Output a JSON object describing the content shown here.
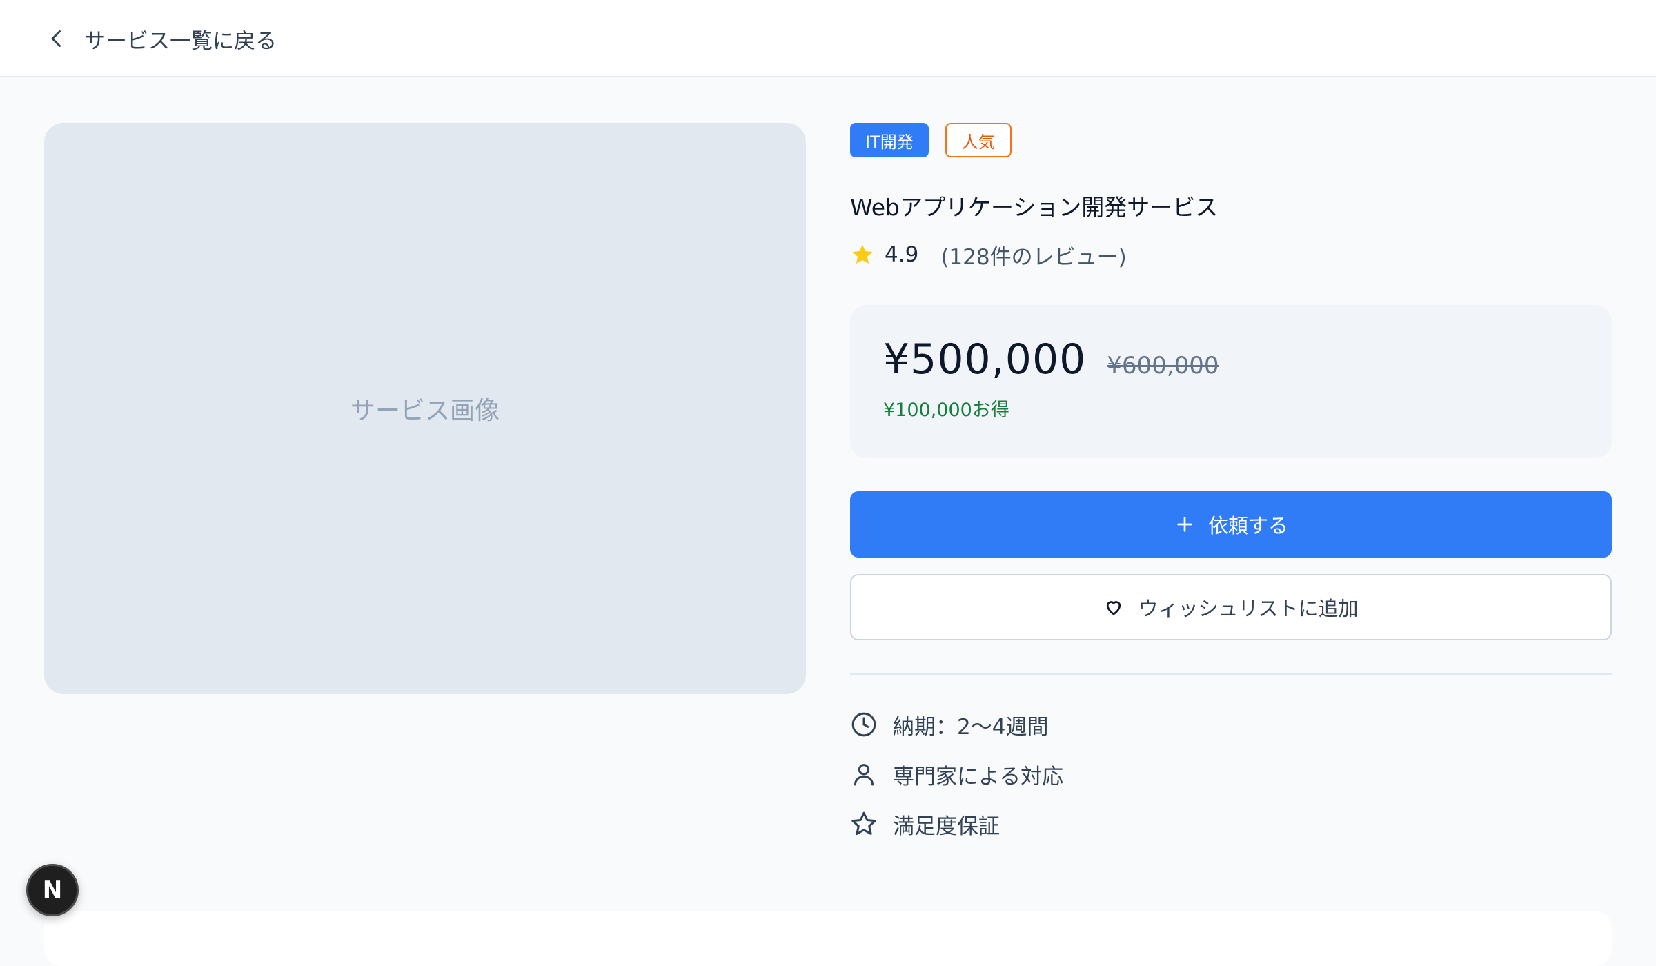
{
  "nav": {
    "back_label": "サービス一覧に戻る"
  },
  "image": {
    "placeholder": "サービス画像"
  },
  "tags": [
    {
      "label": "IT開発"
    },
    {
      "label": "人気"
    }
  ],
  "service": {
    "title": "Webアプリケーション開発サービス",
    "rating": "4.9",
    "reviews": "(128件のレビュー)"
  },
  "pricing": {
    "price": "¥500,000",
    "original_price": "¥600,000",
    "savings": "¥100,000お得"
  },
  "actions": {
    "request_label": "依頼する",
    "wishlist_label": "ウィッシュリストに追加"
  },
  "features": [
    {
      "icon": "clock-icon",
      "label": "納期：2〜4週間"
    },
    {
      "icon": "user-icon",
      "label": "専門家による対応"
    },
    {
      "icon": "star-outline-icon",
      "label": "満足度保証"
    }
  ],
  "badge": {
    "letter": "N"
  },
  "colors": {
    "primary": "#2f7cf6",
    "tag_outline": "#f97316",
    "savings": "#15803d",
    "star": "#facc15",
    "image_placeholder_bg": "#e2e8f0"
  }
}
